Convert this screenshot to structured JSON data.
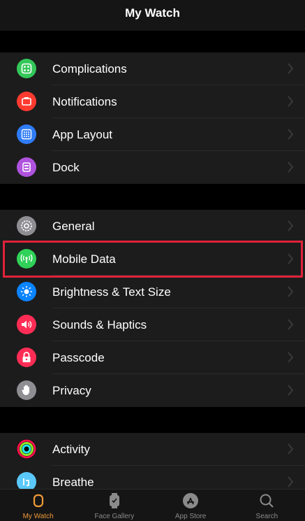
{
  "header": {
    "title": "My Watch"
  },
  "groups": [
    {
      "items": [
        {
          "label": "Complications",
          "icon": "complications-icon",
          "color": "#34c759"
        },
        {
          "label": "Notifications",
          "icon": "notifications-icon",
          "color": "#ff3b30"
        },
        {
          "label": "App Layout",
          "icon": "app-layout-icon",
          "color": "#2f7cf6"
        },
        {
          "label": "Dock",
          "icon": "dock-icon",
          "color": "#af52de"
        }
      ]
    },
    {
      "items": [
        {
          "label": "General",
          "icon": "gear-icon",
          "color": "#8e8e93"
        },
        {
          "label": "Mobile Data",
          "icon": "antenna-icon",
          "color": "#30d158"
        },
        {
          "label": "Brightness & Text Size",
          "icon": "brightness-icon",
          "color": "#0a84ff"
        },
        {
          "label": "Sounds & Haptics",
          "icon": "speaker-icon",
          "color": "#ff2d55"
        },
        {
          "label": "Passcode",
          "icon": "lock-icon",
          "color": "#ff2d55"
        },
        {
          "label": "Privacy",
          "icon": "hand-icon",
          "color": "#8e8e93"
        }
      ]
    },
    {
      "items": [
        {
          "label": "Activity",
          "icon": "activity-rings-icon",
          "color": "#000000"
        },
        {
          "label": "Breathe",
          "icon": "breathe-icon",
          "color": "#5ac8fa"
        }
      ]
    }
  ],
  "highlight_color": "#e0223a",
  "tabbar": {
    "tabs": [
      {
        "label": "My Watch",
        "icon": "watch-icon",
        "active": true
      },
      {
        "label": "Face Gallery",
        "icon": "face-gallery-icon",
        "active": false
      },
      {
        "label": "App Store",
        "icon": "app-store-icon",
        "active": false
      },
      {
        "label": "Search",
        "icon": "search-icon",
        "active": false
      }
    ],
    "active_color": "#f09a37"
  }
}
